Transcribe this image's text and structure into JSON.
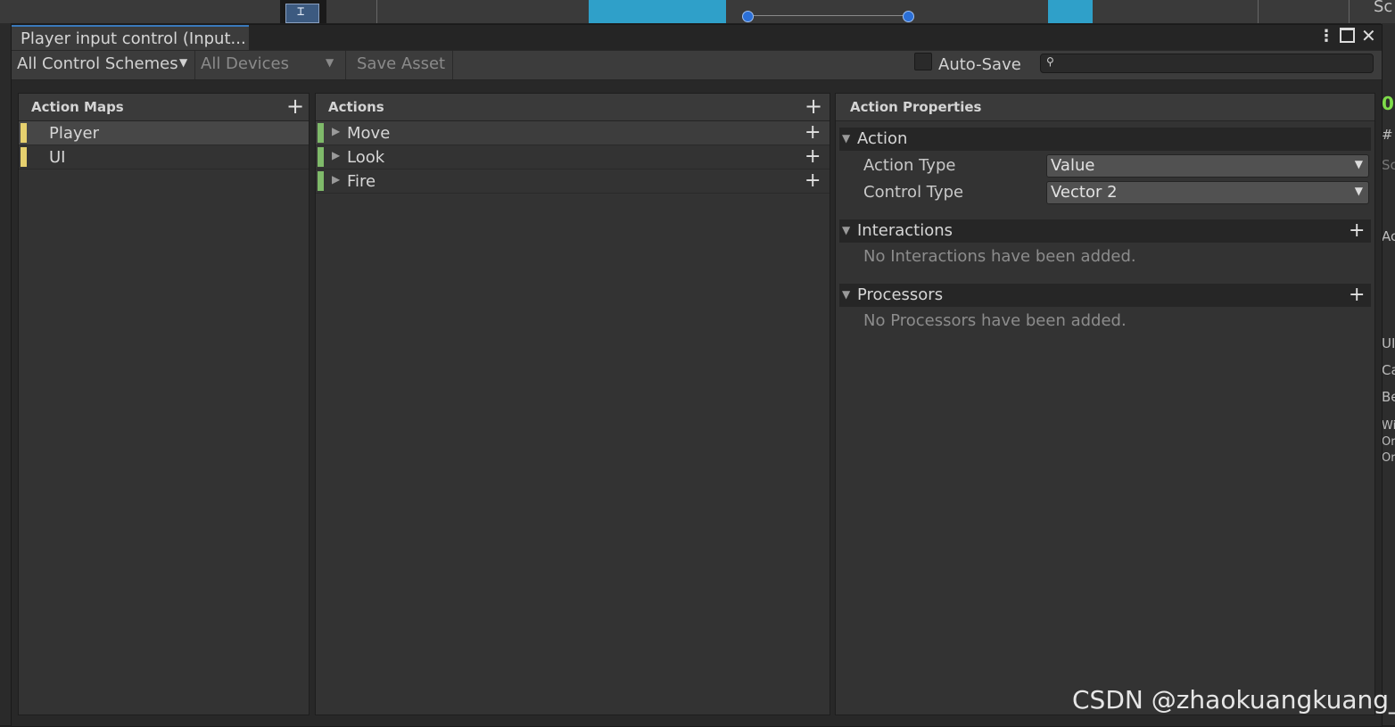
{
  "window": {
    "tab_title": "Player input control (Input...",
    "menu_icon": "kebab-menu-icon",
    "maximize_icon": "maximize-icon",
    "close_icon": "close-icon"
  },
  "background": {
    "top_right_text": "Sc",
    "right_strip_text": [
      "0",
      "#",
      "Sc",
      "Ac",
      "UI",
      "Ca",
      "Be",
      "Wi",
      "Or",
      "Or"
    ]
  },
  "toolbar": {
    "control_schemes": "All Control Schemes",
    "devices": "All Devices",
    "save_asset": "Save Asset",
    "auto_save_label": "Auto-Save",
    "auto_save_checked": false,
    "search_placeholder": "",
    "search_icon": "search-icon"
  },
  "action_maps": {
    "title": "Action Maps",
    "items": [
      {
        "label": "Player",
        "selected": true,
        "color": "#e6d06e"
      },
      {
        "label": "UI",
        "selected": false,
        "color": "#e6d06e"
      }
    ]
  },
  "actions": {
    "title": "Actions",
    "items": [
      {
        "label": "Move",
        "color": "#7fba6a"
      },
      {
        "label": "Look",
        "color": "#7fba6a"
      },
      {
        "label": "Fire",
        "color": "#7fba6a"
      }
    ]
  },
  "properties": {
    "title": "Action Properties",
    "action_section": "Action",
    "action_type_label": "Action Type",
    "action_type_value": "Value",
    "control_type_label": "Control Type",
    "control_type_value": "Vector 2",
    "interactions_section": "Interactions",
    "interactions_empty": "No Interactions have been added.",
    "processors_section": "Processors",
    "processors_empty": "No Processors have been added."
  },
  "watermark": "CSDN @zhaokuangkuang_",
  "colors": {
    "accent_tab": "#3a79bb",
    "map_color": "#e6d06e",
    "action_color": "#7fba6a"
  }
}
